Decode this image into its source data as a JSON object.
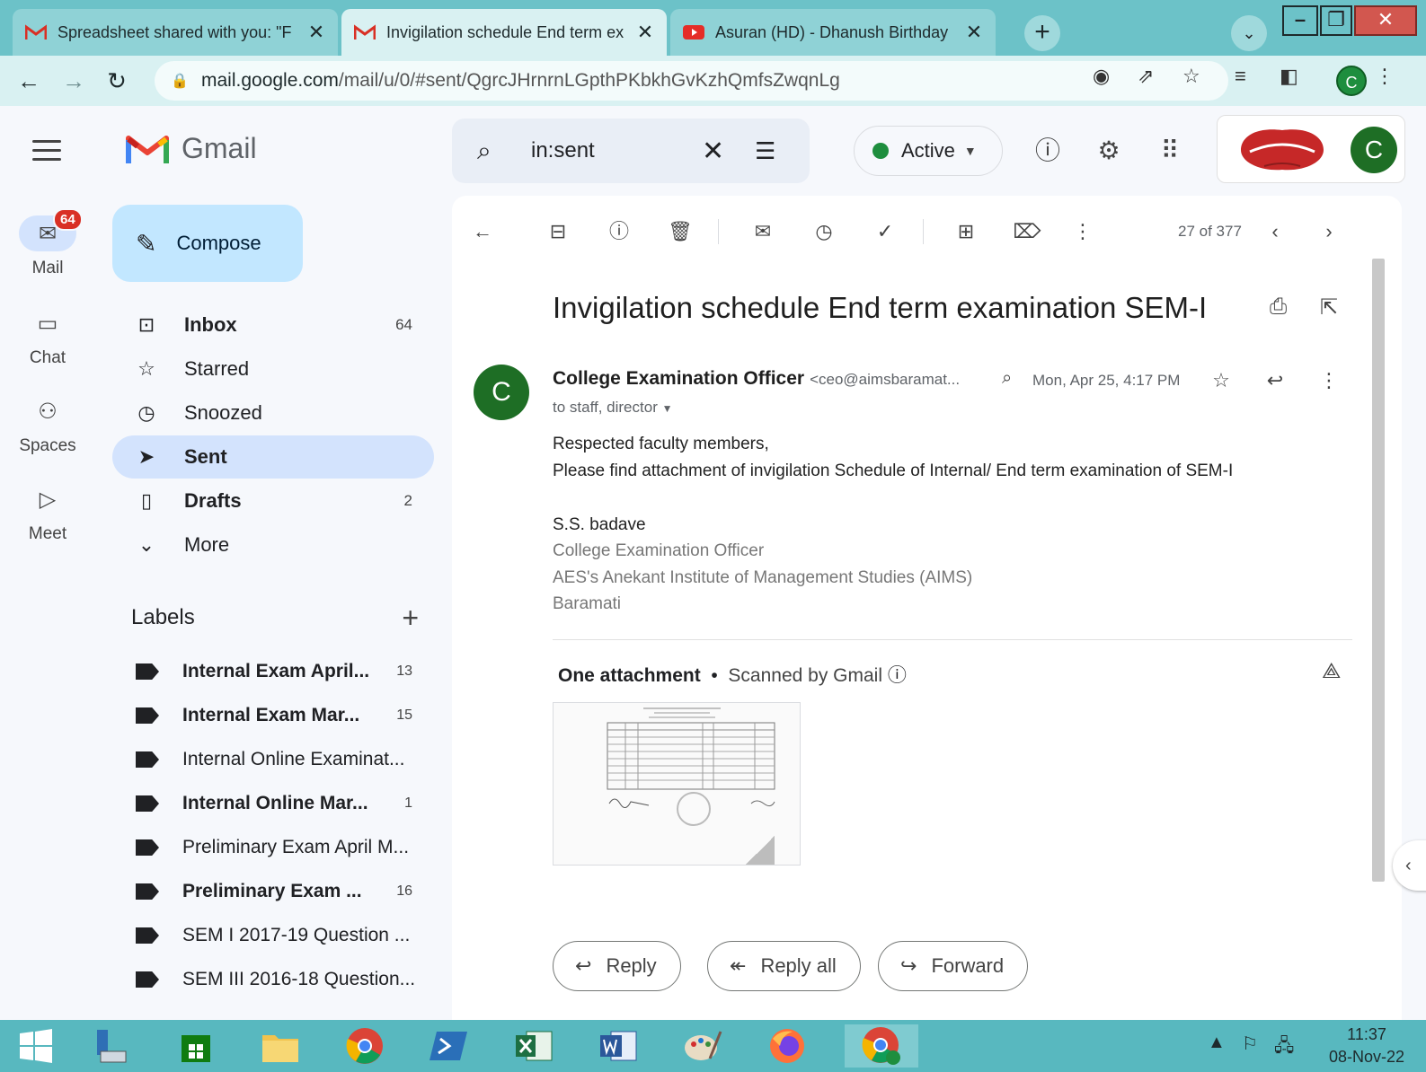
{
  "browser": {
    "tabs": [
      {
        "title": "Spreadsheet shared with you: \"F",
        "active": false
      },
      {
        "title": "Invigilation schedule End term ex",
        "active": true
      },
      {
        "title": "Asuran (HD) - Dhanush Birthday",
        "active": false
      }
    ],
    "url_host": "mail.google.com",
    "url_path": "/mail/u/0/#sent/QgrcJHrnrnLGpthPKbkhGvKzhQmfsZwqnLg",
    "profile_initial": "C"
  },
  "gmail": {
    "app_name": "Gmail",
    "search_query": "in:sent",
    "status": "Active",
    "account_initial": "C",
    "rail": [
      {
        "label": "Mail",
        "badge": "64"
      },
      {
        "label": "Chat"
      },
      {
        "label": "Spaces"
      },
      {
        "label": "Meet"
      }
    ],
    "compose_label": "Compose",
    "nav": [
      {
        "label": "Inbox",
        "count": "64"
      },
      {
        "label": "Starred",
        "count": ""
      },
      {
        "label": "Snoozed",
        "count": ""
      },
      {
        "label": "Sent",
        "count": ""
      },
      {
        "label": "Drafts",
        "count": "2"
      },
      {
        "label": "More",
        "count": ""
      }
    ],
    "labels_title": "Labels",
    "labels": [
      {
        "label": "Internal Exam April...",
        "count": "13"
      },
      {
        "label": "Internal Exam Mar...",
        "count": "15"
      },
      {
        "label": "Internal Online Examinat...",
        "count": ""
      },
      {
        "label": "Internal Online Mar...",
        "count": "1"
      },
      {
        "label": "Preliminary Exam April M...",
        "count": ""
      },
      {
        "label": "Preliminary Exam ...",
        "count": "16"
      },
      {
        "label": "SEM I 2017-19 Question ...",
        "count": ""
      },
      {
        "label": "SEM III 2016-18 Question...",
        "count": ""
      }
    ]
  },
  "message": {
    "pager": "27 of 377",
    "subject": "Invigilation schedule End term examination SEM-I",
    "sender_initial": "C",
    "sender_name": "College Examination Officer",
    "sender_email": "<ceo@aimsbaramat...",
    "date": "Mon, Apr 25, 4:17 PM",
    "to": "to staff, director",
    "body": [
      "Respected faculty members,",
      "Please find attachment of invigilation Schedule of Internal/ End term examination of SEM-I"
    ],
    "signature": [
      "S.S. badave",
      "College Examination Officer",
      "AES's Anekant Institute of Management Studies (AIMS)",
      "Baramati"
    ],
    "attachment_title": "One attachment",
    "attachment_scan": "Scanned by Gmail",
    "actions": {
      "reply": "Reply",
      "reply_all": "Reply all",
      "forward": "Forward"
    }
  },
  "taskbar": {
    "time": "11:37",
    "date": "08-Nov-22"
  },
  "colors": {
    "chrome_theme": "#6cc2c8",
    "gmail_bg": "#f6f8fc",
    "compose_bg": "#c2e7ff",
    "selected_nav": "#d3e3fd",
    "avatar_green": "#1e6e25",
    "badge_red": "#d93025"
  }
}
